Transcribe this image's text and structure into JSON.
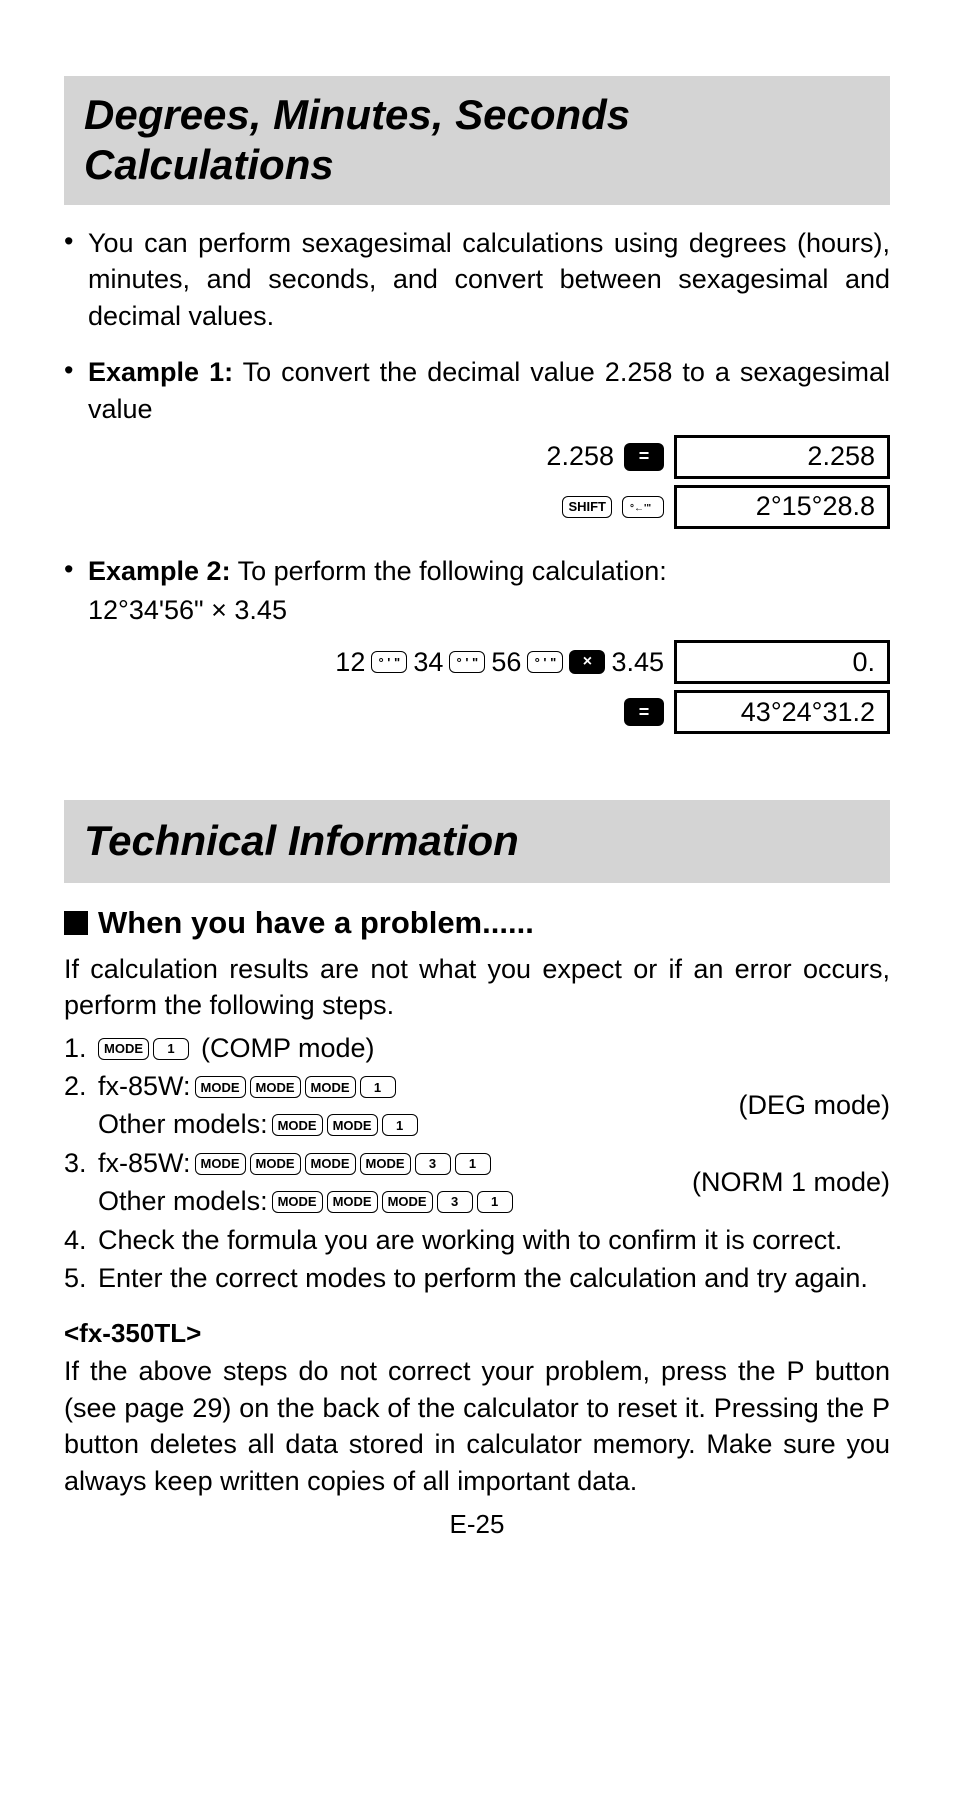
{
  "section1": {
    "title": "Degrees, Minutes, Seconds Calculations",
    "bullet1": "You can perform sexagesimal calculations using degrees (hours), minutes, and seconds, and convert between sexagesimal and decimal values.",
    "example1_label": "Example 1:",
    "example1_text": "  To convert the decimal value 2.258 to a sexagesimal value",
    "ex1_line1_input": "2.258",
    "ex1_line1_display": "2.258",
    "ex1_line2_display": "2°15°28.8",
    "example2_label": "Example 2:",
    "example2_text": "  To perform the following calculation:",
    "ex2_expr": "12°34'56\" × 3.45",
    "ex2_seq_12": "12",
    "ex2_seq_34": "34",
    "ex2_seq_56": "56",
    "ex2_seq_345": "3.45",
    "ex2_disp1": "0.",
    "ex2_disp2": "43°24°31.2"
  },
  "keys": {
    "equals": "=",
    "shift": "SHIFT",
    "dms": "° ' \"",
    "dms_arrow": "←°'\"",
    "times": "×",
    "mode": "MODE",
    "k1": "1",
    "k3": "3"
  },
  "section2": {
    "title": "Technical Information",
    "sub": "When you have a problem......",
    "intro": "If calculation results are not what you expect or if an error occurs, perform the following steps.",
    "step1_num": "1.",
    "step1_note": "(COMP mode)",
    "step2_num": "2.",
    "step2_a": "fx-85W:",
    "step2_b": "Other models:",
    "step2_note": "(DEG mode)",
    "step3_num": "3.",
    "step3_a": "fx-85W:",
    "step3_b": "Other models:",
    "step3_note": "(NORM 1 mode)",
    "step4_num": "4.",
    "step4_text": "Check the formula you are working with to confirm it is correct.",
    "step5_num": "5.",
    "step5_text": "Enter the correct modes to perform the calculation and try again.",
    "model_heading": "<fx-350TL>",
    "model_para": "If the above steps do not correct your problem, press the P button (see page 29) on the back of the calculator to reset it. Pressing the P button deletes all data stored in calculator memory. Make sure you always keep written copies of all important data."
  },
  "page_number": "E-25"
}
